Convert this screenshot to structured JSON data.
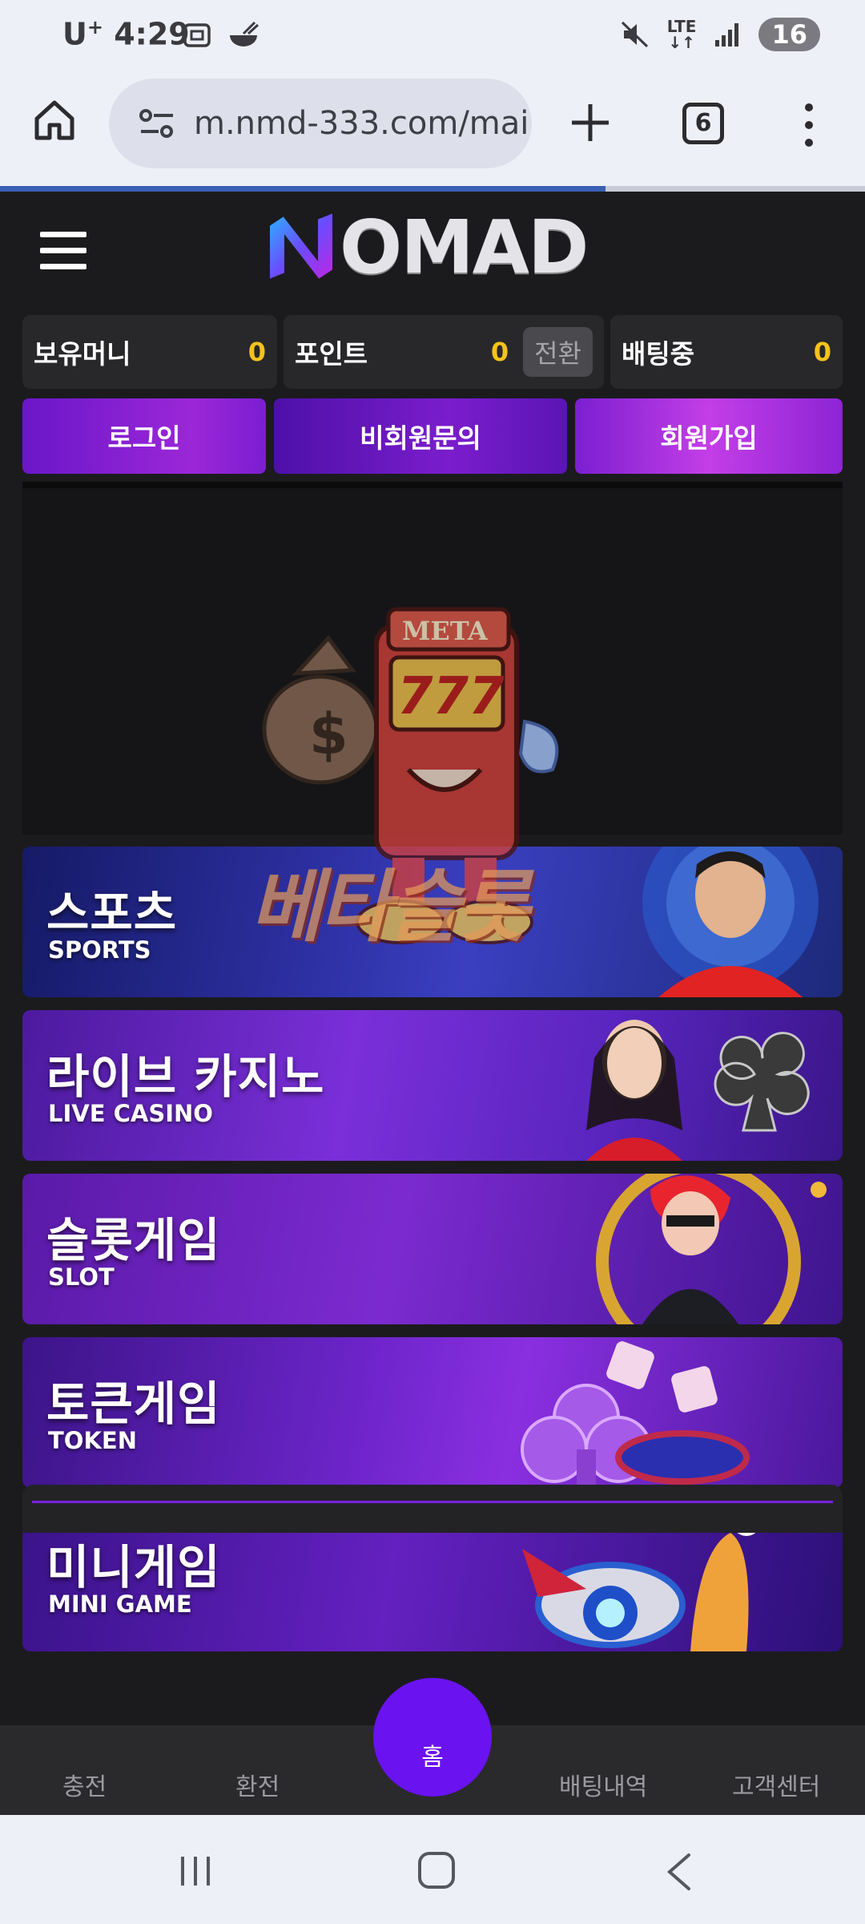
{
  "status_bar": {
    "carrier": "U",
    "carrier_sup": "+",
    "time": "4:29",
    "network": "LTE",
    "battery": "16"
  },
  "browser": {
    "url": "m.nmd-333.com/mai",
    "tab_count": "6",
    "load_progress": 0.7
  },
  "site": {
    "logo_text": "OMAD",
    "balances": [
      {
        "label": "보유머니",
        "value": "0"
      },
      {
        "label": "포인트",
        "value": "0",
        "action": "전환"
      },
      {
        "label": "배팅중",
        "value": "0"
      }
    ],
    "auth": {
      "login": "로그인",
      "inquiry": "비회원문의",
      "join": "회원가입"
    },
    "games": [
      {
        "ko": "스포츠",
        "en": "SPORTS"
      },
      {
        "ko": "라이브 카지노",
        "en": "LIVE CASINO"
      },
      {
        "ko": "슬롯게임",
        "en": "SLOT"
      },
      {
        "ko": "토큰게임",
        "en": "TOKEN"
      },
      {
        "ko": "미니게임",
        "en": "MINI GAME"
      }
    ],
    "watermark": {
      "sign": "META",
      "reels": "777",
      "text": "베타슬롯"
    }
  },
  "bottom_nav": {
    "charge": "충전",
    "exchange": "환전",
    "home": "홈",
    "bet_history": "배팅내역",
    "support": "고객센터"
  },
  "colors": {
    "accent": "#6a12f0",
    "balance_value": "#f5c21b",
    "page_bg": "#1b1b1d"
  }
}
